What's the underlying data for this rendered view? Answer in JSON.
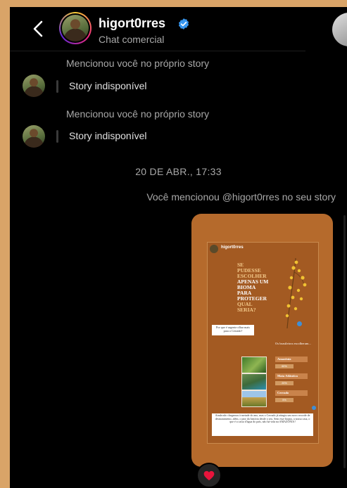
{
  "header": {
    "username": "higort0rres",
    "subtitle": "Chat comercial",
    "icons": {
      "back": "chevron-left-icon",
      "verified": "verified-badge-icon"
    }
  },
  "messages": [
    {
      "label": "Mencionou você no próprio story",
      "story_text": "Story indisponível"
    },
    {
      "label": "Mencionou você no próprio story",
      "story_text": "Story indisponível"
    }
  ],
  "timestamp": "20 DE ABR., 17:33",
  "you_mentioned": "Você mencionou @higort0rres no seu story",
  "story": {
    "inner_username": "higort0rres",
    "headline_lines": [
      {
        "text": "SE",
        "highlight": false
      },
      {
        "text": "PUDESSE",
        "highlight": false
      },
      {
        "text": "ESCOLHER",
        "highlight": false
      },
      {
        "text": "APENAS UM",
        "highlight": true
      },
      {
        "text": "BIOMA",
        "highlight": true
      },
      {
        "text": "PARA",
        "highlight": true
      },
      {
        "text": "PROTEGER",
        "highlight": true
      },
      {
        "text": "QUAL",
        "highlight": false
      },
      {
        "text": "SERIA?",
        "highlight": false
      }
    ],
    "question": "Por que é urgente olhar mais para o Cerrado?",
    "answers_heading": "Os brasileiros escolheram...",
    "options": [
      {
        "label": "Amazônia",
        "pct": "60%"
      },
      {
        "label": "Mata Atlântica",
        "pct": "20%"
      },
      {
        "label": "Cerrado",
        "pct": "5%"
      }
    ],
    "caption": "Ainda não chegamos à metade do ano, mas o Cerrado já atingiu um novo recorde de desmatamento, além, o pior da história desde o seu. Sem esse bioma, a nossa casa, o que é a caixa d'água do país, não há vida na AMAZÔNIA!"
  },
  "reaction": {
    "emoji": "❤️"
  },
  "colors": {
    "frame_bg": "#000000",
    "story_bg": "#b56a2c",
    "accent": "#3797f0",
    "heart": "#e8143c"
  }
}
